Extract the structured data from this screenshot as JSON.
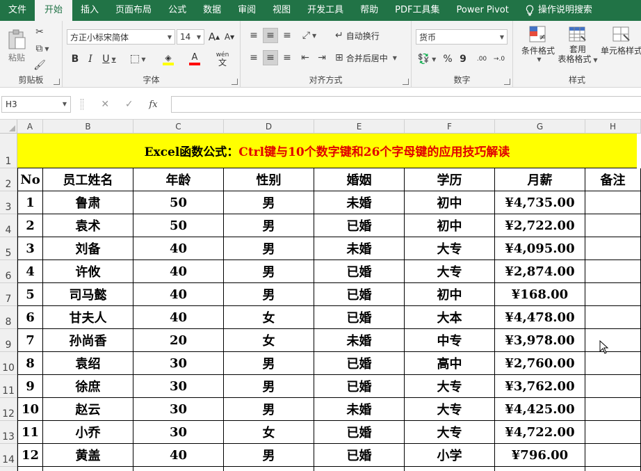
{
  "menu": {
    "tabs": [
      "文件",
      "开始",
      "插入",
      "页面布局",
      "公式",
      "数据",
      "审阅",
      "视图",
      "开发工具",
      "帮助",
      "PDF工具集",
      "Power Pivot"
    ],
    "active_index": 1,
    "search_label": "操作说明搜索"
  },
  "ribbon": {
    "clipboard": {
      "paste": "粘贴",
      "label": "剪贴板"
    },
    "font": {
      "name": "方正小标宋简体",
      "size": "14",
      "grow": "A",
      "shrink": "A",
      "bold": "B",
      "italic": "I",
      "underline": "U",
      "wen": "wén",
      "label": "字体"
    },
    "alignment": {
      "wrap": "自动换行",
      "merge": "合并后居中",
      "label": "对齐方式"
    },
    "number": {
      "format": "货币",
      "percent": "%",
      "comma": "9",
      "inc": ".00",
      "dec": "→.0",
      "label": "数字"
    },
    "styles": {
      "conditional": "条件格式",
      "table_line1": "套用",
      "table_line2": "表格格式",
      "cell_styles": "单元格样式",
      "label": "样式"
    }
  },
  "formula_bar": {
    "name_box": "H3",
    "cancel": "✕",
    "enter": "✓",
    "fx": "fx",
    "value": ""
  },
  "sheet": {
    "columns": [
      "A",
      "B",
      "C",
      "D",
      "E",
      "F",
      "G",
      "H"
    ],
    "row_numbers": [
      "1",
      "2",
      "3",
      "4",
      "5",
      "6",
      "7",
      "8",
      "9",
      "10",
      "11",
      "12",
      "13",
      "14"
    ],
    "title_black_1": "Excel函数公式：",
    "title_red": "Ctrl键与10个数字键和26个字母键的应用技巧解读",
    "headers": [
      "No",
      "员工姓名",
      "年龄",
      "性别",
      "婚姻",
      "学历",
      "月薪",
      "备注"
    ],
    "rows": [
      [
        "1",
        "鲁肃",
        "50",
        "男",
        "未婚",
        "初中",
        "¥4,735.00",
        ""
      ],
      [
        "2",
        "袁术",
        "50",
        "男",
        "已婚",
        "初中",
        "¥2,722.00",
        ""
      ],
      [
        "3",
        "刘备",
        "40",
        "男",
        "未婚",
        "大专",
        "¥4,095.00",
        ""
      ],
      [
        "4",
        "许攸",
        "40",
        "男",
        "已婚",
        "大专",
        "¥2,874.00",
        ""
      ],
      [
        "5",
        "司马懿",
        "40",
        "男",
        "已婚",
        "初中",
        "¥168.00",
        ""
      ],
      [
        "6",
        "甘夫人",
        "40",
        "女",
        "已婚",
        "大本",
        "¥4,478.00",
        ""
      ],
      [
        "7",
        "孙尚香",
        "20",
        "女",
        "未婚",
        "中专",
        "¥3,978.00",
        ""
      ],
      [
        "8",
        "袁绍",
        "30",
        "男",
        "已婚",
        "高中",
        "¥2,760.00",
        ""
      ],
      [
        "9",
        "徐庶",
        "30",
        "男",
        "已婚",
        "大专",
        "¥3,762.00",
        ""
      ],
      [
        "10",
        "赵云",
        "30",
        "男",
        "未婚",
        "大专",
        "¥4,425.00",
        ""
      ],
      [
        "11",
        "小乔",
        "30",
        "女",
        "已婚",
        "大专",
        "¥4,722.00",
        ""
      ],
      [
        "12",
        "黄盖",
        "40",
        "男",
        "已婚",
        "小学",
        "¥796.00",
        ""
      ]
    ]
  }
}
